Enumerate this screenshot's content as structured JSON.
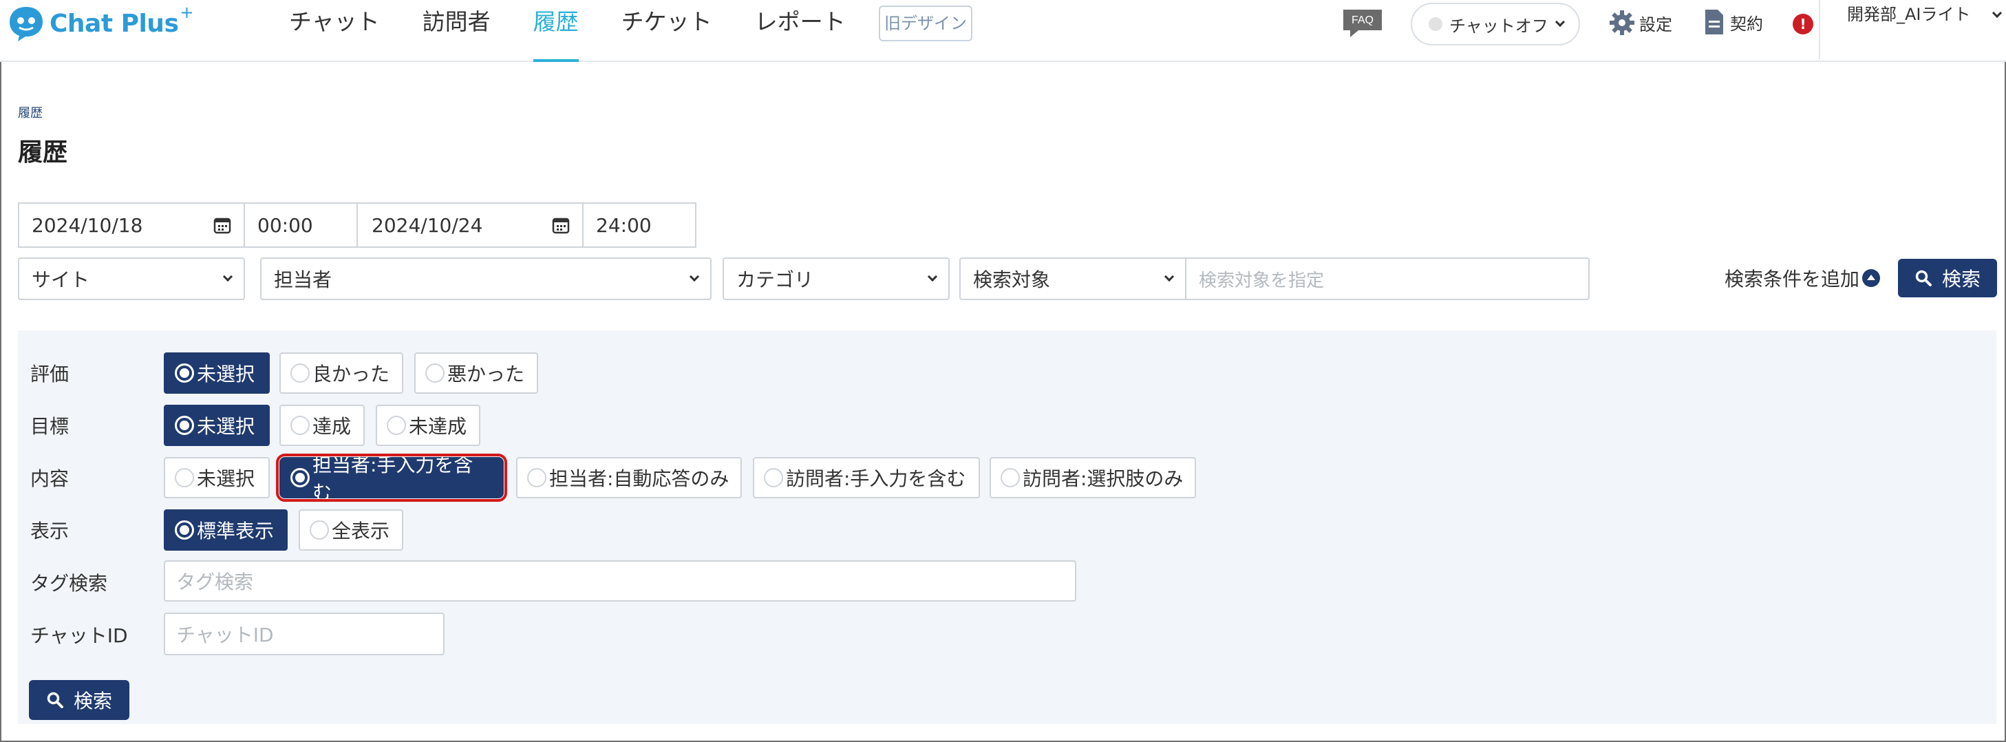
{
  "header": {
    "logo_text": "Chat Plus",
    "logo_sup": "+",
    "nav": [
      {
        "label": "チャット",
        "active": false
      },
      {
        "label": "訪問者",
        "active": false
      },
      {
        "label": "履歴",
        "active": true
      },
      {
        "label": "チケット",
        "active": false
      },
      {
        "label": "レポート",
        "active": false
      }
    ],
    "old_design": "旧デザイン",
    "faq": "FAQ",
    "chat_status": "チャットオフ",
    "settings": "設定",
    "contract": "契約",
    "alert": "!",
    "user": "開発部_AIライト"
  },
  "page": {
    "breadcrumb": "履歴",
    "title": "履歴"
  },
  "filters": {
    "date_from": "2024/10/18",
    "time_from": "00:00",
    "date_to": "2024/10/24",
    "time_to": "24:00",
    "site": "サイト",
    "agent": "担当者",
    "category": "カテゴリ",
    "search_target": "検索対象",
    "search_target_placeholder": "検索対象を指定",
    "add_condition": "検索条件を追加",
    "search_button": "検索"
  },
  "panel": {
    "rows": {
      "rating": {
        "label": "評価",
        "options": [
          "未選択",
          "良かった",
          "悪かった"
        ],
        "selected": 0
      },
      "goal": {
        "label": "目標",
        "options": [
          "未選択",
          "達成",
          "未達成"
        ],
        "selected": 0
      },
      "content": {
        "label": "内容",
        "options": [
          "未選択",
          "担当者:手入力を含む",
          "担当者:自動応答のみ",
          "訪問者:手入力を含む",
          "訪問者:選択肢のみ"
        ],
        "selected": 1
      },
      "display": {
        "label": "表示",
        "options": [
          "標準表示",
          "全表示"
        ],
        "selected": 0
      }
    },
    "tag_search": {
      "label": "タグ検索",
      "placeholder": "タグ検索"
    },
    "chat_id": {
      "label": "チャットID",
      "placeholder": "チャットID"
    },
    "search_button": "検索"
  },
  "colors": {
    "primary": "#1f3a6e",
    "accent": "#2ab0d6",
    "alert": "#cc1f25",
    "focus_outline": "#d21b1b"
  }
}
